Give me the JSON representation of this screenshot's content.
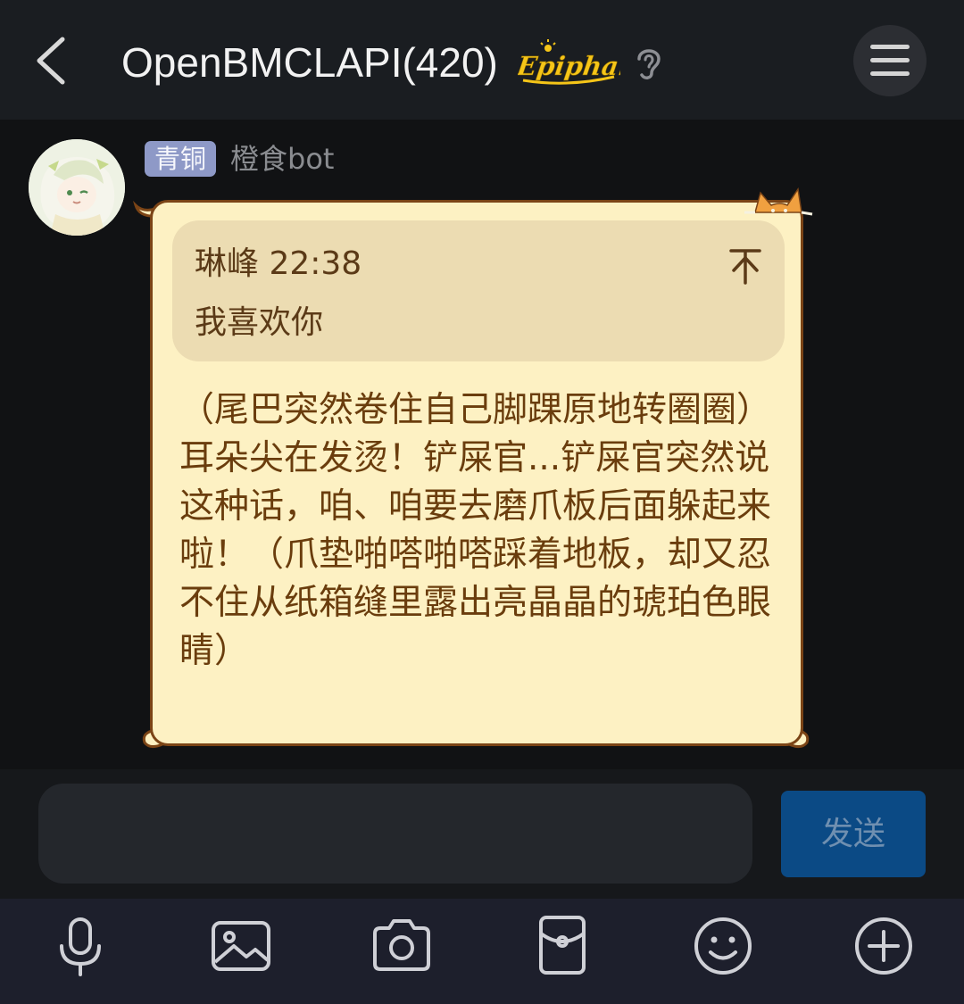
{
  "header": {
    "title": "OpenBMCLAPI(420)",
    "epiphany_logo_text": "Epiphany",
    "back_icon": "chevron-left-icon",
    "ear_icon": "ear-icon",
    "menu_icon": "hamburger-menu-icon"
  },
  "message": {
    "badge": "青铜",
    "sender": "橙食bot",
    "quote": {
      "author_time": "琳峰 22:38",
      "text": "我喜欢你",
      "jump_icon": "scroll-to-top-icon"
    },
    "text": "（尾巴突然卷住自己脚踝原地转圈圈）耳朵尖在发烫！铲屎官...铲屎官突然说这种话，咱、咱要去磨爪板后面躲起来啦！（爪垫啪嗒啪嗒踩着地板，却又忍不住从纸箱缝里露出亮晶晶的琥珀色眼睛）"
  },
  "composer": {
    "placeholder": "",
    "send_label": "发送"
  },
  "toolbar": {
    "items": [
      "microphone-icon",
      "image-icon",
      "camera-icon",
      "red-packet-icon",
      "emoji-icon",
      "plus-icon"
    ]
  },
  "colors": {
    "bubble_bg": "#fdf1c3",
    "bubble_border": "#7b4416",
    "badge_bg": "#8e99c7",
    "send_bg": "#0b4a85"
  }
}
